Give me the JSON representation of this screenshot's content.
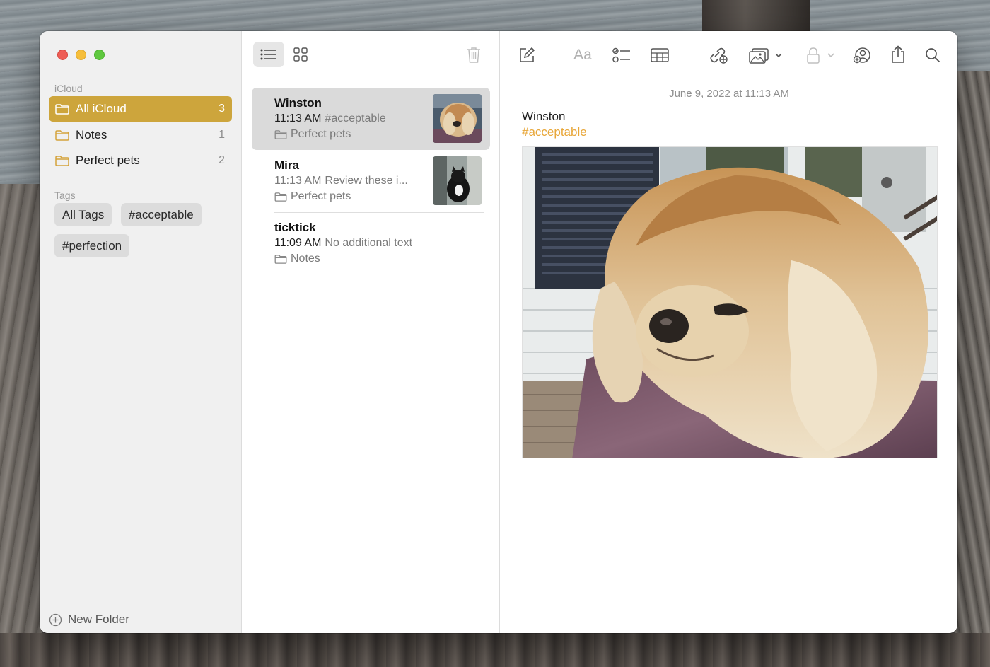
{
  "sidebar": {
    "account_label": "iCloud",
    "folders": [
      {
        "label": "All iCloud",
        "count": "3"
      },
      {
        "label": "Notes",
        "count": "1"
      },
      {
        "label": "Perfect pets",
        "count": "2"
      }
    ],
    "tags_label": "Tags",
    "tags": [
      "All Tags",
      "#acceptable",
      "#perfection"
    ],
    "new_folder_label": "New Folder"
  },
  "notes": [
    {
      "title": "Winston",
      "time": "11:13 AM",
      "preview": "#acceptable",
      "folder": "Perfect pets"
    },
    {
      "title": "Mira",
      "time": "11:13 AM",
      "preview": "Review these i...",
      "folder": "Perfect pets"
    },
    {
      "title": "ticktick",
      "time": "11:09 AM",
      "preview": "No additional text",
      "folder": "Notes"
    }
  ],
  "editor": {
    "date": "June 9, 2022 at 11:13 AM",
    "heading": "Winston",
    "tag": "#acceptable",
    "format_label": "Aa"
  },
  "colors": {
    "accent": "#cda53c",
    "tag": "#e8a73a"
  }
}
